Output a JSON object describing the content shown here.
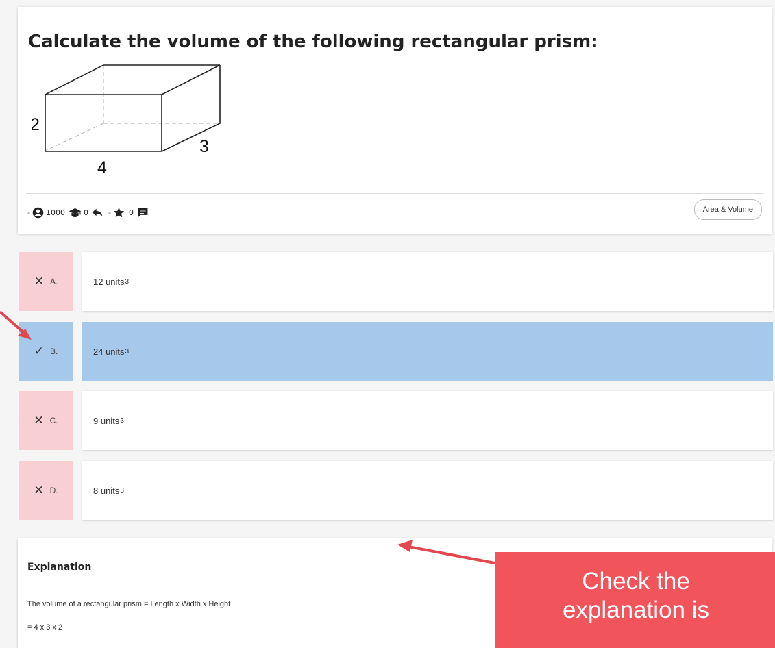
{
  "question": {
    "title": "Calculate the volume of the following rectangular prism:",
    "figure": {
      "height_label": "2",
      "length_label": "4",
      "width_label": "3"
    },
    "meta": {
      "lead_dash": "-",
      "views": "1000",
      "graduates": "0",
      "separator": "-",
      "stars": "0",
      "tag": "Area & Volume"
    }
  },
  "answers": [
    {
      "letter": "A.",
      "value": "12 units",
      "sup": "3",
      "status": "wrong"
    },
    {
      "letter": "B.",
      "value": "24 units",
      "sup": "3",
      "status": "correct"
    },
    {
      "letter": "C.",
      "value": "9 units",
      "sup": "3",
      "status": "wrong"
    },
    {
      "letter": "D.",
      "value": "8 units",
      "sup": "3",
      "status": "wrong"
    }
  ],
  "explanation": {
    "heading": "Explanation",
    "line1": "The volume of a rectangular prism = Length x Width x Height",
    "line2": "= 4 x 3 x 2"
  },
  "callout": {
    "line1": "Check the",
    "line2": "explanation is"
  },
  "colors": {
    "wrong": "#f8cfd2",
    "correct": "#a6c8ea",
    "callout": "#f2545b"
  }
}
